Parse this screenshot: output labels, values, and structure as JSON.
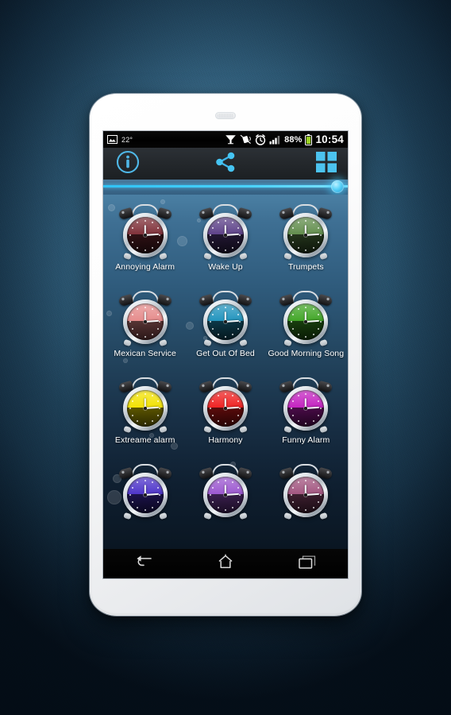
{
  "device": {
    "type": "white-android-smartphone",
    "speaker_grill": "earpiece-speaker"
  },
  "status_bar": {
    "gallery_icon": "gallery-photo-icon",
    "temperature": "22°",
    "glass_icon": "drink-glass-icon",
    "vibrate_off_icon": "vibrate-muted-icon",
    "alarm_icon": "alarm-clock-icon",
    "signal_icon": "signal-bars-icon",
    "battery_percent": "88%",
    "battery_icon": "battery-icon",
    "clock": "10:54"
  },
  "action_bar": {
    "info_label": "i",
    "info_icon": "info-circle-icon",
    "share_icon": "share-nodes-icon",
    "grid_icon": "grid-view-icon"
  },
  "seekbar": {
    "accent_color": "#3fcdf5",
    "value_percent": 100
  },
  "app": {
    "background_top_color": "#4a7fa3",
    "background_bottom_color": "#0a1622",
    "label_color": "#ffffff"
  },
  "ringtones": [
    {
      "label": "Annoying Alarm",
      "face_color": "#7d2d36",
      "face_color2": "#5a1f2a"
    },
    {
      "label": "Wake Up",
      "face_color": "#5b3f87",
      "face_color2": "#3d2a63"
    },
    {
      "label": "Trumpets",
      "face_color": "#5f8c4a",
      "face_color2": "#3f6432"
    },
    {
      "label": "Mexican Service",
      "face_color": "#e58a8a",
      "face_color2": "#cf6f74"
    },
    {
      "label": "Get Out Of Bed",
      "face_color": "#1f93bd",
      "face_color2": "#16718f"
    },
    {
      "label": "Good Morning Song",
      "face_color": "#3fa524",
      "face_color2": "#2c7d18"
    },
    {
      "label": "Extreame alarm",
      "face_color": "#f2e200",
      "face_color2": "#d6c600"
    },
    {
      "label": "Harmony",
      "face_color": "#ef1f1f",
      "face_color2": "#c10f11"
    },
    {
      "label": "Funny Alarm",
      "face_color": "#c31fc0",
      "face_color2": "#9a0f96"
    },
    {
      "label": "",
      "face_color": "#4b31c9",
      "face_color2": "#31208f"
    },
    {
      "label": "",
      "face_color": "#9a55cf",
      "face_color2": "#7a3ba8"
    },
    {
      "label": "",
      "face_color": "#a1537e",
      "face_color2": "#7d3a60"
    }
  ],
  "nav_bar": {
    "back_icon": "back-arrow-icon",
    "home_icon": "home-icon",
    "recents_icon": "recent-apps-icon"
  }
}
